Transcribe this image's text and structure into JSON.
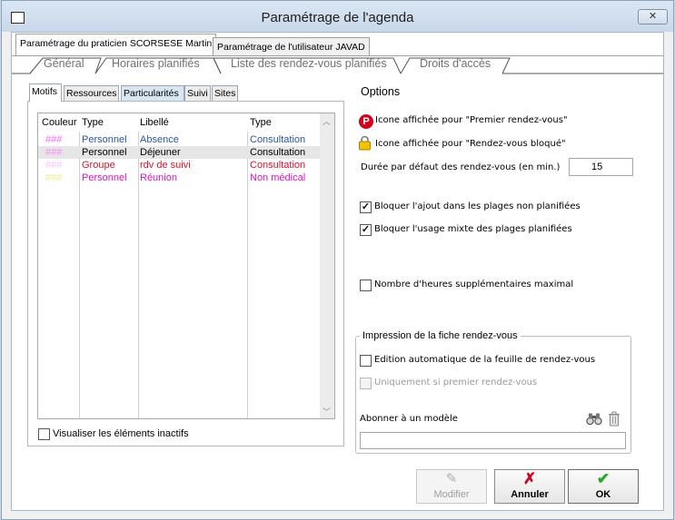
{
  "window": {
    "title": "Paramétrage de l'agenda",
    "close_label": "✕"
  },
  "primary_tabs": [
    {
      "label": "Paramétrage du praticien SCORSESE Martin"
    },
    {
      "label": "Paramétrage de l'utilisateur JAVAD"
    }
  ],
  "secondary_tabs": [
    {
      "label": "Général"
    },
    {
      "label": "Horaires planifiés"
    },
    {
      "label": "Liste des rendez-vous planifiés"
    },
    {
      "label": "Droits d'accès"
    }
  ],
  "tertiary_tabs": [
    {
      "label": "Motifs"
    },
    {
      "label": "Ressources"
    },
    {
      "label": "Particularités"
    },
    {
      "label": "Suivi"
    },
    {
      "label": "Sites"
    }
  ],
  "motifs_table": {
    "columns": [
      "Couleur",
      "Type",
      "Libellé",
      "Type"
    ],
    "rows": [
      {
        "color_text": "###",
        "color": "#ff66ff",
        "type": "Personnel",
        "libelle": "Absence",
        "type2": "Consultation",
        "text_color": "#2b55a6"
      },
      {
        "color_text": "###",
        "color": "#ff88ff",
        "type": "Personnel",
        "libelle": "Déjeuner",
        "type2": "Consultation",
        "text_color": "#000000"
      },
      {
        "color_text": "###",
        "color": "#ffc0ff",
        "type": "Groupe",
        "libelle": "rdv de suivi",
        "type2": "Consultation",
        "text_color": "#e0102a"
      },
      {
        "color_text": "###",
        "color": "#e8f08a",
        "type": "Personnel",
        "libelle": "Réunion",
        "type2": "Non médical",
        "text_color": "#e010c8"
      }
    ]
  },
  "show_inactive": {
    "label": "Visualiser les éléments inactifs",
    "checked": false
  },
  "options": {
    "title": "Options",
    "icon_first": {
      "label": "Icone affichée pour \"Premier rendez-vous\"",
      "icon_letter": "P"
    },
    "icon_blocked": {
      "label": "Icone affichée pour \"Rendez-vous bloqué\""
    },
    "duration": {
      "label": "Durée par défaut des rendez-vous (en min.)",
      "value": "15"
    },
    "block_add": {
      "label": "Bloquer l'ajout dans les plages non planifiées",
      "checked": true
    },
    "block_mixed": {
      "label": "Bloquer l'usage mixte des plages planifiées",
      "checked": true
    },
    "max_hours": {
      "label": "Nombre d'heures supplémentaires maximal",
      "checked": false
    }
  },
  "print": {
    "title": "Impression de la fiche rendez-vous",
    "auto_edit": {
      "label": "Edition automatique de la feuille de rendez-vous",
      "checked": false
    },
    "first_only": {
      "label": "Uniquement si premier rendez-vous",
      "checked": false
    },
    "subscribe_label": "Abonner à un modèle",
    "subscribe_value": ""
  },
  "buttons": {
    "modifier": "Modifier",
    "annuler": "Annuler",
    "ok": "OK"
  },
  "colors": {
    "accent_red": "#d0021b",
    "ok_green": "#2aa52a"
  }
}
